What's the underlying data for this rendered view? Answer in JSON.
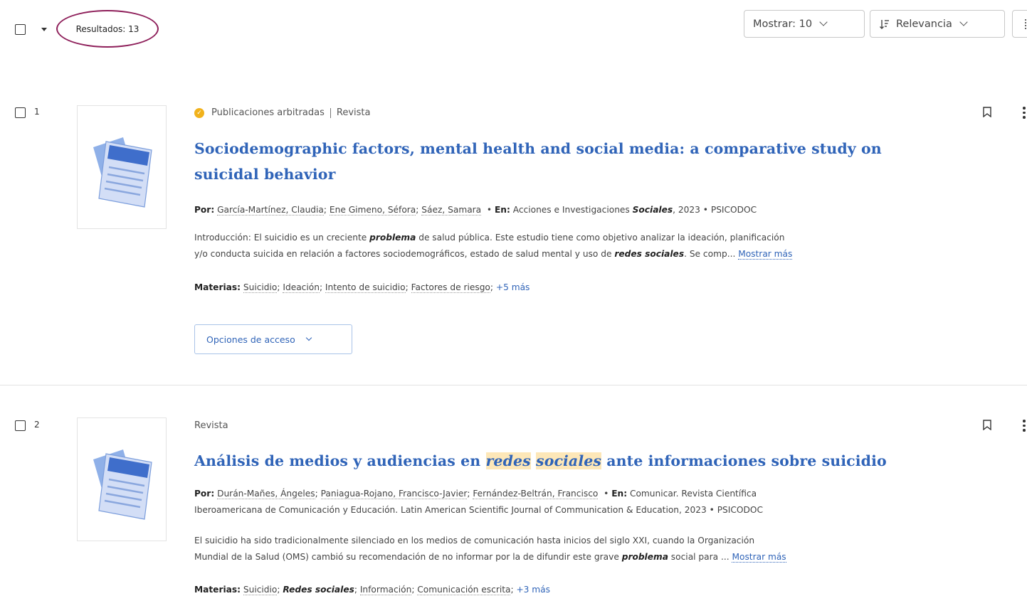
{
  "toolbar": {
    "results_label": "Resultados: 13",
    "show_label": "Mostrar: 10",
    "sort_label": "Relevancia"
  },
  "results": [
    {
      "number": "1",
      "peer_reviewed": "Publicaciones arbitradas",
      "type": "Revista",
      "title_line1": "Sociodemographic factors, mental health and social media: a comparative study on",
      "title_line2": "suicidal behavior",
      "by_label": "Por:",
      "authors": [
        "García-Martínez, Claudia",
        "Ene Gimeno, Séfora",
        "Sáez, Samara"
      ],
      "in_label": "En:",
      "source_prefix": "Acciones e Investigaciones",
      "source_em": "Sociales",
      "source_suffix": ", 2023 • PSICODOC",
      "abstract_a": "Introducción: El suicidio es un creciente",
      "abstract_em1": "problema",
      "abstract_b": "de salud pública. Este estudio tiene como objetivo analizar la ideación, planificación",
      "abstract_c": "y/o conducta suicida en relación a factores sociodemográficos, estado de salud mental y uso de",
      "abstract_em2": "redes sociales",
      "abstract_d": ". Se comp...",
      "more": "Mostrar más",
      "subjects_label": "Materias:",
      "subjects": [
        "Suicidio",
        "Ideación",
        "Intento de suicidio",
        "Factores de riesgo"
      ],
      "subjects_more": "+5 más",
      "access_button": "Opciones de acceso"
    },
    {
      "number": "2",
      "type": "Revista",
      "title_a": "Análisis de medios y audiencias en",
      "title_hl1": "redes",
      "title_hl2": "sociales",
      "title_b": "ante informaciones sobre suicidio",
      "by_label": "Por:",
      "authors": [
        "Durán-Mañes, Ángeles",
        "Paniagua-Rojano, Francisco-Javier",
        "Fernández-Beltrán, Francisco"
      ],
      "in_label": "En:",
      "source_line1": "Comunicar. Revista Científica",
      "source_line2": "Iberoamericana de Comunicación y Educación. Latin American Scientific Journal of Communication & Education, 2023 • PSICODOC",
      "abstract_a": "El suicidio ha sido tradicionalmente silenciado en los medios de comunicación hasta inicios del siglo XXI, cuando la Organización",
      "abstract_b": "Mundial de la Salud (OMS) cambió su recomendación de no informar por la de difundir este grave",
      "abstract_em1": "problema",
      "abstract_c": "social para ...",
      "more": "Mostrar más",
      "subjects_label": "Materias:",
      "subject1": "Suicidio",
      "subject2_em": "Redes sociales",
      "subject3": "Información",
      "subject4": "Comunicación escrita",
      "subjects_more": "+3 más"
    }
  ],
  "colors": {
    "link": "#3064b8",
    "highlight": "#fde7b8",
    "annotation_circle": "#8e1f5a",
    "badge": "#f1b21c"
  },
  "icons": [
    "checkbox-icon",
    "caret-down-icon",
    "sort-icon",
    "chevron-down-icon",
    "peer-reviewed-badge-icon",
    "bookmark-icon",
    "more-options-icon",
    "document-thumbnail-icon"
  ]
}
